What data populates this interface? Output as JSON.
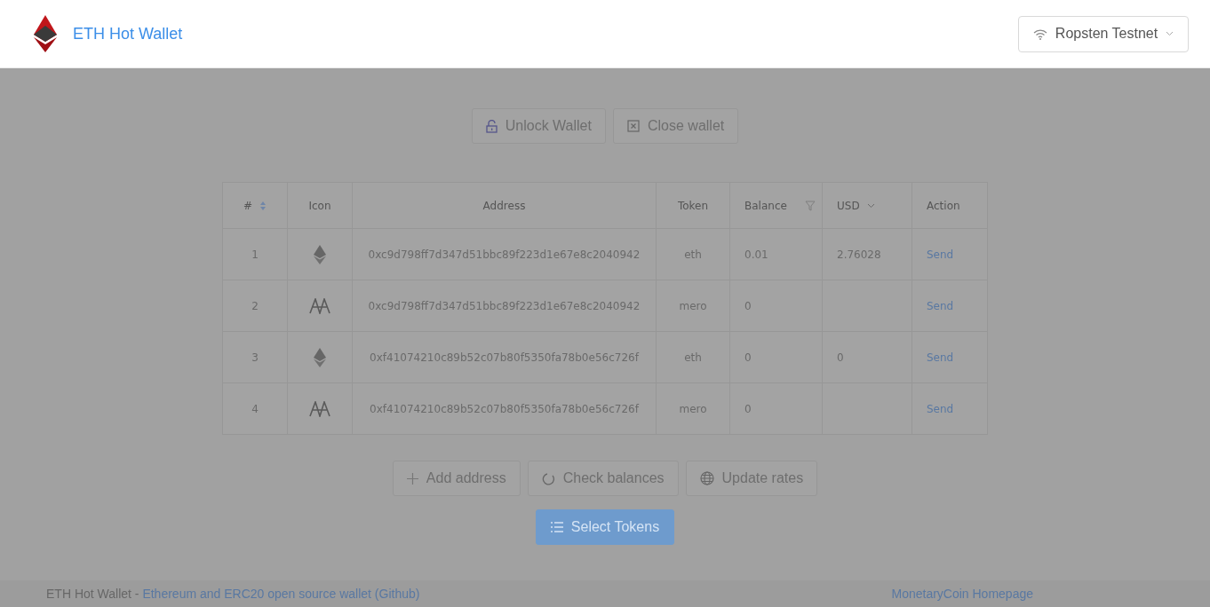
{
  "header": {
    "title": "ETH Hot Wallet",
    "network": "Ropsten Testnet"
  },
  "top_buttons": [
    {
      "label": "Unlock Wallet",
      "kind": "lock"
    },
    {
      "label": "Close wallet",
      "kind": "close"
    }
  ],
  "table": {
    "columns": [
      {
        "label": "#",
        "sort": true
      },
      {
        "label": "Icon"
      },
      {
        "label": "Address"
      },
      {
        "label": "Token"
      },
      {
        "label": "Balance",
        "filter": true
      },
      {
        "label": "USD",
        "dropdown": true
      },
      {
        "label": "Action"
      }
    ],
    "rows": [
      {
        "index": "1",
        "kind": "eth",
        "address": "0xc9d798ff7d347d51bbc89f223d1e67e8c2040942",
        "token": "eth",
        "balance": "0.01",
        "usd": "2.76028",
        "action": "Send"
      },
      {
        "index": "2",
        "kind": "mero",
        "address": "0xc9d798ff7d347d51bbc89f223d1e67e8c2040942",
        "token": "mero",
        "balance": "0",
        "action": "Send"
      },
      {
        "index": "3",
        "kind": "eth",
        "address": "0xf41074210c89b52c07b80f5350fa78b0e56c726f",
        "token": "eth",
        "balance": "0",
        "usd": "0",
        "action": "Send"
      },
      {
        "index": "4",
        "kind": "mero",
        "address": "0xf41074210c89b52c07b80f5350fa78b0e56c726f",
        "token": "mero",
        "balance": "0",
        "action": "Send"
      }
    ]
  },
  "bottom_buttons": [
    {
      "label": "Add address",
      "kind": "plus"
    },
    {
      "label": "Check balances",
      "kind": "reload"
    },
    {
      "label": "Update rates",
      "kind": "globe"
    }
  ],
  "primary_button": {
    "label": "Select Tokens"
  },
  "footer": {
    "text": "ETH Hot Wallet - ",
    "link": "Ethereum and ERC20 open source wallet (Github)",
    "right_link": "MonetaryCoin Homepage"
  }
}
